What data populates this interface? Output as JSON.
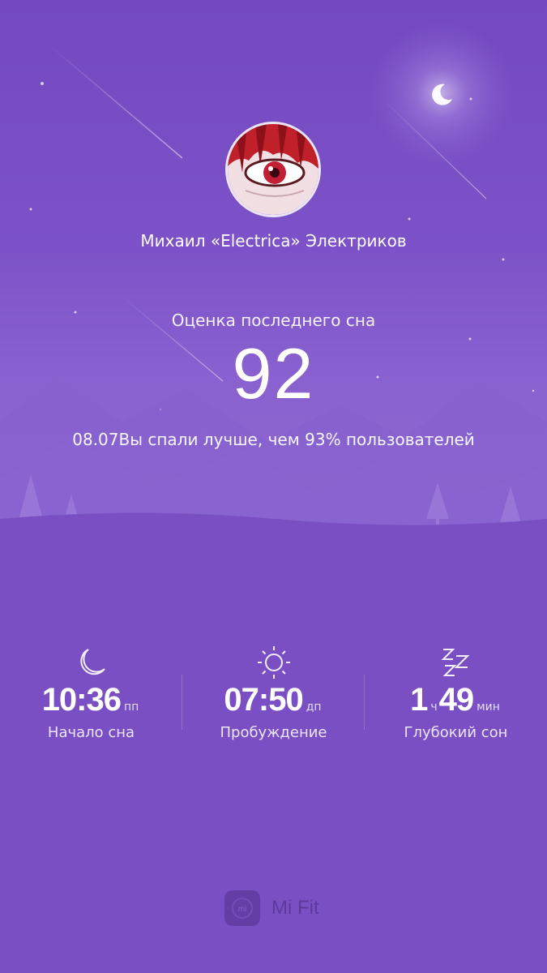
{
  "profile": {
    "username": "Михаил «Electrica» Электриков"
  },
  "sleep_score": {
    "label": "Оценка последнего сна",
    "value": "92",
    "comparison": "08.07Вы спали лучше, чем 93% пользователей"
  },
  "stats": [
    {
      "icon": "moon-icon",
      "value": "10:36",
      "unit": "пп",
      "label": "Начало сна"
    },
    {
      "icon": "sun-icon",
      "value": "07:50",
      "unit": "дп",
      "label": "Пробуждение"
    },
    {
      "icon": "zzz-icon",
      "hours": "1",
      "hours_unit": "ч",
      "minutes": "49",
      "minutes_unit": "мин",
      "label": "Глубокий сон"
    }
  ],
  "brand": {
    "logo_text": "mi",
    "name": "Mi Fit"
  },
  "colors": {
    "background": "#7a4fc4",
    "text": "#ffffff"
  }
}
